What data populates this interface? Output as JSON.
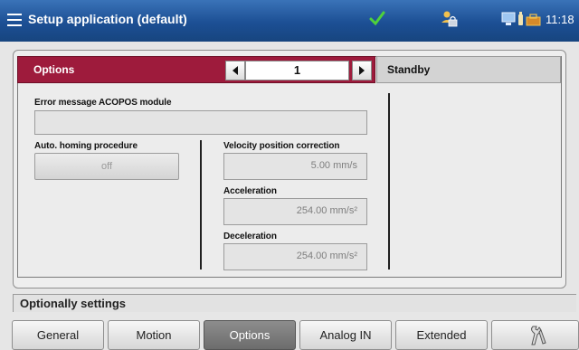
{
  "titlebar": {
    "title": "Setup application (default)",
    "time": "11:18",
    "icons": [
      "menu-icon",
      "checkmark-icon",
      "user-lock-icon",
      "monitor-icon",
      "bottle-icon",
      "toolbox-icon"
    ]
  },
  "header": {
    "section_label": "Options",
    "index_value": "1",
    "state": "Standby"
  },
  "form": {
    "error_label": "Error message ACOPOS module",
    "error_value": "",
    "homing_label": "Auto. homing procedure",
    "homing_button": "off",
    "velocity_label": "Velocity position correction",
    "velocity_value": "5.00  mm/s",
    "acceleration_label": "Acceleration",
    "acceleration_value": "254.00  mm/s²",
    "deceleration_label": "Deceleration",
    "deceleration_value": "254.00  mm/s²"
  },
  "status": {
    "text": "Optionally settings"
  },
  "tabs": [
    {
      "label": "General"
    },
    {
      "label": "Motion"
    },
    {
      "label": "Options"
    },
    {
      "label": "Analog IN"
    },
    {
      "label": "Extended"
    }
  ],
  "colors": {
    "titlebar": "#1c4f94",
    "header_accent": "#9e1b3c",
    "active_tab": "#7a7a7a"
  }
}
